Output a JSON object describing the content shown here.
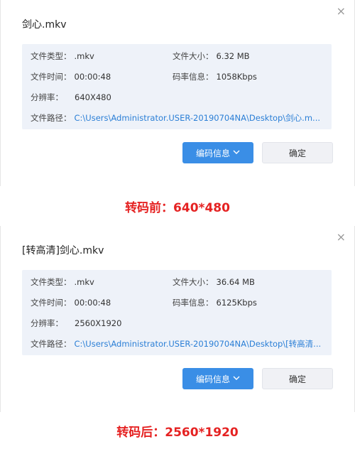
{
  "dialogs": [
    {
      "title": "剑心.mkv",
      "close_glyph": "×",
      "file_type_label": "文件类型：",
      "file_type": ".mkv",
      "file_size_label": "文件大小：",
      "file_size": "6.32 MB",
      "file_time_label": "文件时间：",
      "file_time": "00:00:48",
      "bitrate_label": "码率信息：",
      "bitrate": "1058Kbps",
      "resolution_label": "分辨率：",
      "resolution": "640X480",
      "path_label": "文件路径：",
      "path": "C:\\Users\\Administrator.USER-20190704NA\\Desktop\\剑心.m...",
      "info_button": "编码信息",
      "ok_button": "确定"
    },
    {
      "title": "[转高清]剑心.mkv",
      "close_glyph": "×",
      "file_type_label": "文件类型：",
      "file_type": ".mkv",
      "file_size_label": "文件大小：",
      "file_size": "36.64 MB",
      "file_time_label": "文件时间：",
      "file_time": "00:00:48",
      "bitrate_label": "码率信息：",
      "bitrate": "6125Kbps",
      "resolution_label": "分辨率：",
      "resolution": "2560X1920",
      "path_label": "文件路径：",
      "path": "C:\\Users\\Administrator.USER-20190704NA\\Desktop\\[转高清...",
      "info_button": "编码信息",
      "ok_button": "确定"
    }
  ],
  "captions": {
    "before": "转码前：640*480",
    "after": "转码后：2560*1920"
  },
  "colors": {
    "primary": "#3a8ee6",
    "caption": "#e52222",
    "path_link": "#2b7fd6",
    "info_bg": "#eef2f9"
  }
}
